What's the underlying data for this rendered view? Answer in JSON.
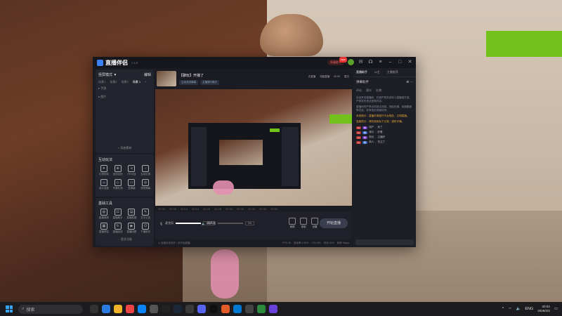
{
  "app": {
    "name": "直播伴侣",
    "version": "7.1.5",
    "upgrade_label": "升级助手",
    "badge": "NEW"
  },
  "scenes": {
    "mode_label": "竖屏模式 ▼",
    "edit_label": "编辑",
    "tabs": [
      "场景1",
      "场景2",
      "场景3",
      "场景 1"
    ],
    "active_tab": "场景 1",
    "sources": [
      "手游",
      "图片"
    ],
    "add_source": "+ 添加素材"
  },
  "interactive": {
    "title": "互动玩法",
    "items": [
      "礼物特效",
      "连线合拍",
      "PK对战",
      "互动礼物",
      "观众连麦",
      "专属礼物",
      "发弹幕",
      "语音弹幕"
    ]
  },
  "tools": {
    "title": "基础工具",
    "items": [
      "直播美颜",
      "直播助手",
      "直播数据",
      "文字公告",
      "直播预告",
      "直播回放",
      "直播回看",
      "下播助手"
    ],
    "more": "··· 更多功能"
  },
  "live_info": {
    "title": "【聊玩】开播了",
    "tags": [
      "主动关闭弹幕",
      "主播暂时离开"
    ],
    "right_items": [
      "去直播",
      "电脑直播",
      "00:00",
      "暂无"
    ]
  },
  "timeline": {
    "ticks": [
      "00:00",
      "00:05",
      "00:10",
      "00:15",
      "00:20",
      "00:25",
      "00:30",
      "00:35",
      "00:40",
      "00:45",
      "00:50"
    ]
  },
  "controls": {
    "mic_label": "麦克风",
    "mic_volume": 100,
    "mic_pct": "100%",
    "speaker_label": "扬声器",
    "speaker_volume": 0,
    "speaker_pct": "0%",
    "buttons": [
      "美颜",
      "录制",
      "设置"
    ],
    "go_live": "开始直播"
  },
  "status": {
    "left": "◎ 连接状态良好 / 未开始直播",
    "right": [
      "FPS 30",
      "丢帧率 0.00%",
      "CPU 5%",
      "内存 52%",
      "码率 0kbps"
    ]
  },
  "right_panel": {
    "tabs": [
      "直播助手",
      "AI主",
      "主播推荐"
    ],
    "header": "弹幕助手",
    "sub_tabs": [
      "评论",
      "观众",
      "礼物"
    ],
    "notices": [
      "欢迎来到直播间，抖音严禁未成年人直播或打赏，严禁发布违法违规内容。",
      "直播间内严禁出现违法违规、低俗色情、吸烟酗酒等内容，若有违反将被封禁。",
      "系统提示：直播时请遵守平台规范，文明直播。",
      "温馨提示：请勿相信私下交易，谨防诈骗。"
    ],
    "chat": [
      {
        "user": "用户",
        "text": "来了"
      },
      {
        "user": "观众",
        "text": "好看"
      },
      {
        "user": "粉丝",
        "text": "主播好"
      },
      {
        "user": "新人",
        "text": "关注了"
      }
    ]
  },
  "taskbar": {
    "search_placeholder": "搜索",
    "lang": "ENG",
    "time": "20:03",
    "date": "2026/2/3"
  },
  "colors": {
    "accent_green": "#72c21b",
    "brand_blue": "#3b82f6",
    "window_bg": "#1a1b23"
  }
}
